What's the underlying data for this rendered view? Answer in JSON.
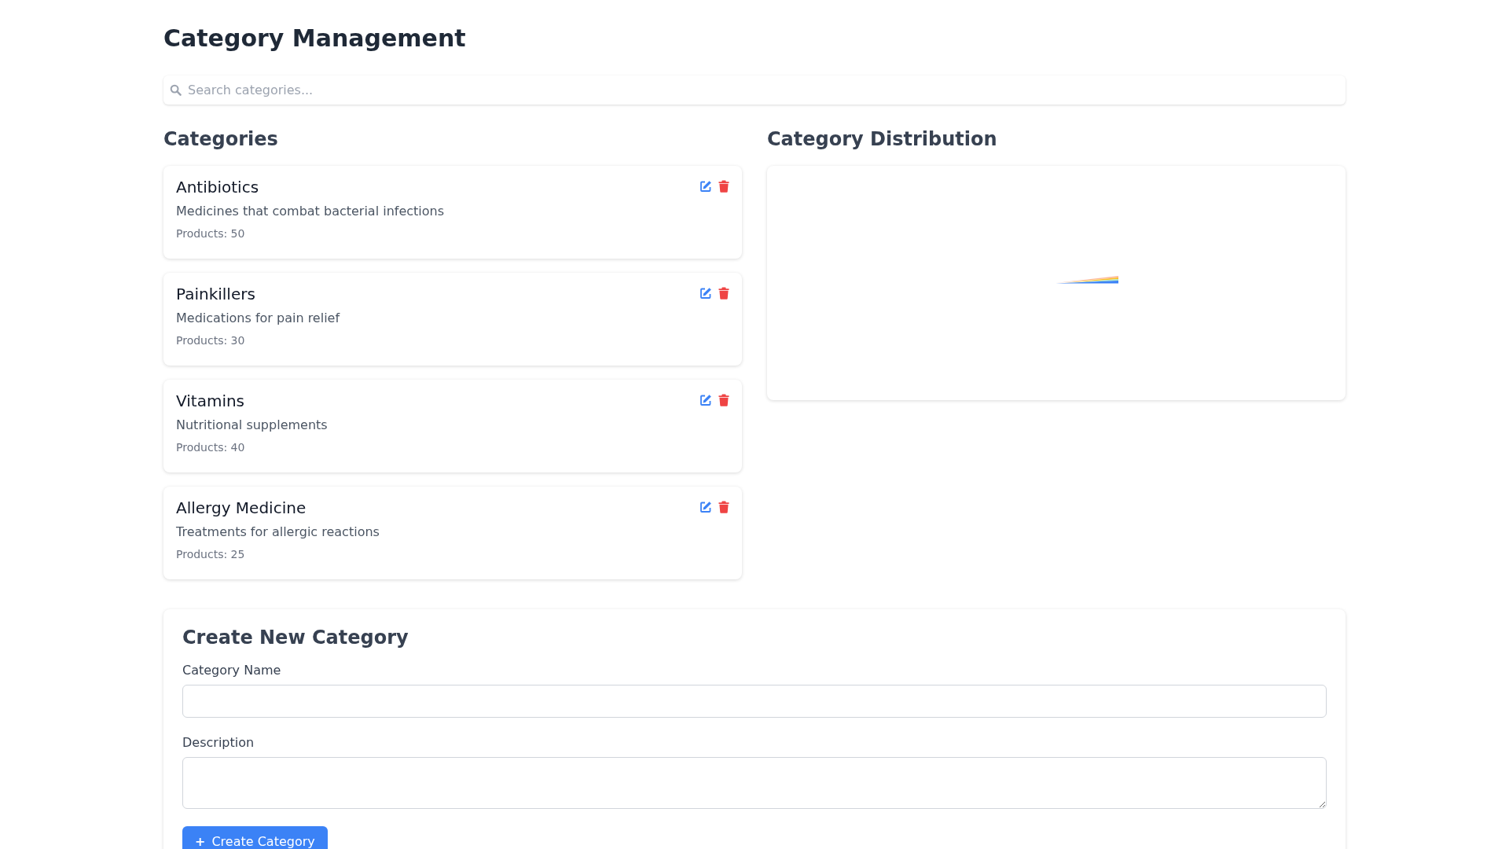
{
  "page": {
    "title": "Category Management"
  },
  "search": {
    "placeholder": "Search categories..."
  },
  "categories": {
    "heading": "Categories",
    "items": [
      {
        "name": "Antibiotics",
        "description": "Medicines that combat bacterial infections",
        "products": "Products: 50"
      },
      {
        "name": "Painkillers",
        "description": "Medications for pain relief",
        "products": "Products: 30"
      },
      {
        "name": "Vitamins",
        "description": "Nutritional supplements",
        "products": "Products: 40"
      },
      {
        "name": "Allergy Medicine",
        "description": "Treatments for allergic reactions",
        "products": "Products: 25"
      }
    ]
  },
  "distribution": {
    "heading": "Category Distribution"
  },
  "create_form": {
    "heading": "Create New Category",
    "fields": [
      {
        "kind": "input",
        "label": "Category Name"
      },
      {
        "kind": "textarea",
        "label": "Description"
      }
    ],
    "submit": {
      "icon": "+",
      "label": "Create Category"
    }
  }
}
